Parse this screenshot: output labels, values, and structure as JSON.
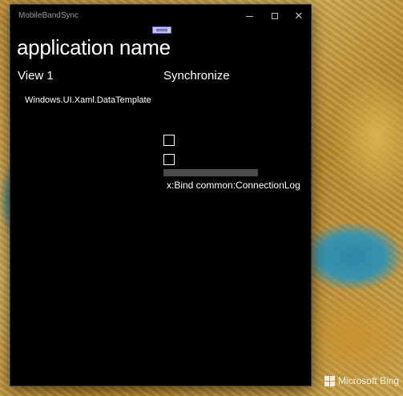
{
  "window": {
    "title": "MobileBandSync",
    "controls": {
      "minimize": "minimize-icon",
      "maximize": "maximize-icon",
      "close": "close-icon"
    }
  },
  "app": {
    "name": "application name"
  },
  "left_pane": {
    "title": "View 1",
    "items": [
      "Windows.UI.Xaml.DataTemplate"
    ]
  },
  "right_pane": {
    "title": "Synchronize",
    "checkboxes": [
      {
        "checked": false
      },
      {
        "checked": false
      }
    ],
    "connection_log": "x:Bind common:ConnectionLog"
  },
  "desktop": {
    "watermark": "Microsoft Bing"
  },
  "colors": {
    "window_bg": "#000000",
    "text": "#ffffff",
    "progress_track": "#4a4a4a"
  }
}
